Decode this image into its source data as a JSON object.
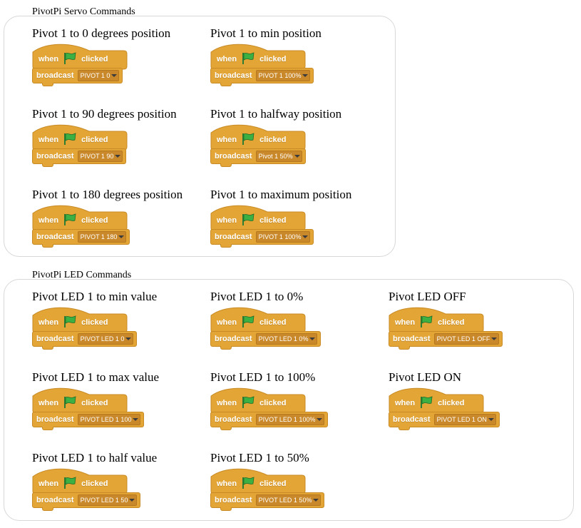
{
  "colors": {
    "block": "#e3a536",
    "block_dark": "#c88a24",
    "flag": "#3cb043",
    "panel_border": "#d8d8d8"
  },
  "block_text": {
    "when": "when",
    "clicked": "clicked",
    "broadcast": "broadcast",
    "flag_icon": "green-flag-icon"
  },
  "servo": {
    "title": "PivotPi Servo Commands",
    "commands": [
      {
        "label": "Pivot 1 to 0 degrees position",
        "message": "PIVOT 1 0"
      },
      {
        "label": "Pivot 1 to min position",
        "message": "PIVOT 1 100%"
      },
      {
        "label": "Pivot 1 to 90 degrees position",
        "message": "PIVOT 1 90"
      },
      {
        "label": "Pivot 1 to halfway position",
        "message": "Pivot 1 50%"
      },
      {
        "label": "Pivot 1 to 180 degrees position",
        "message": "PIVOT 1 180"
      },
      {
        "label": "Pivot 1 to maximum position",
        "message": "PIVOT 1 100%"
      }
    ]
  },
  "led": {
    "title": "PivotPi LED Commands",
    "commands": [
      {
        "label": "Pivot LED 1 to min value",
        "message": "PIVOT LED 1 0"
      },
      {
        "label": "Pivot LED 1 to 0%",
        "message": "PIVOT LED 1 0%"
      },
      {
        "label": "Pivot LED OFF",
        "message": "PIVOT LED 1 OFF"
      },
      {
        "label": "Pivot LED 1 to max value",
        "message": "PIVOT LED 1 100"
      },
      {
        "label": "Pivot LED 1 to 100%",
        "message": "PIVOT LED 1 100%"
      },
      {
        "label": "Pivot LED ON",
        "message": "PIVOT LED 1 ON"
      },
      {
        "label": "Pivot LED 1 to half value",
        "message": "PIVOT LED 1 50"
      },
      {
        "label": "Pivot LED 1 to 50%",
        "message": "PIVOT LED 1 50%"
      }
    ]
  }
}
